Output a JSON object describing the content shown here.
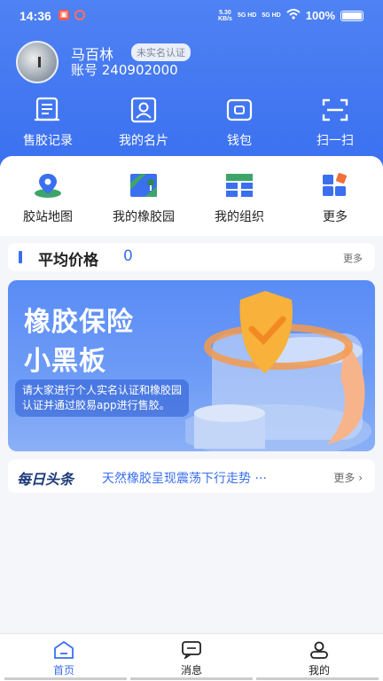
{
  "status_bar": {
    "time": "14:36",
    "net_speed": "5.30",
    "net_unit": "KB/s",
    "sig1": "5G HD",
    "sig2": "5G HD",
    "battery": "100%"
  },
  "profile": {
    "name": "马百林",
    "verify_badge": "未实名认证",
    "account": "账号 240902000"
  },
  "quick_actions": [
    {
      "label": "售胶记录",
      "icon": "document-list-icon"
    },
    {
      "label": "我的名片",
      "icon": "id-card-icon"
    },
    {
      "label": "钱包",
      "icon": "wallet-icon"
    },
    {
      "label": "扫一扫",
      "icon": "scan-icon"
    }
  ],
  "grid_menu": [
    {
      "label": "胶站地图",
      "icon": "map-pin-icon"
    },
    {
      "label": "我的橡胶园",
      "icon": "plantation-map-icon"
    },
    {
      "label": "我的组织",
      "icon": "organization-icon"
    },
    {
      "label": "更多",
      "icon": "apps-grid-icon"
    }
  ],
  "price": {
    "label": "平均价格",
    "value": "0",
    "more": "更多"
  },
  "banner": {
    "title_line1": "橡胶保险",
    "title_line2": "小黑板",
    "note": "请大家进行个人实名认证和橡胶园认证并通过胶易app进行售胶。"
  },
  "news": {
    "brand": "每日头条",
    "headline": "天然橡胶呈现震荡下行走势 ···",
    "more": "更多 ›"
  },
  "tabs": [
    {
      "label": "首页",
      "icon": "home-icon",
      "active": true
    },
    {
      "label": "消息",
      "icon": "message-icon",
      "active": false
    },
    {
      "label": "我的",
      "icon": "user-icon",
      "active": false
    }
  ],
  "colors": {
    "primary": "#3a6ff0",
    "header": "#4f82f3"
  }
}
